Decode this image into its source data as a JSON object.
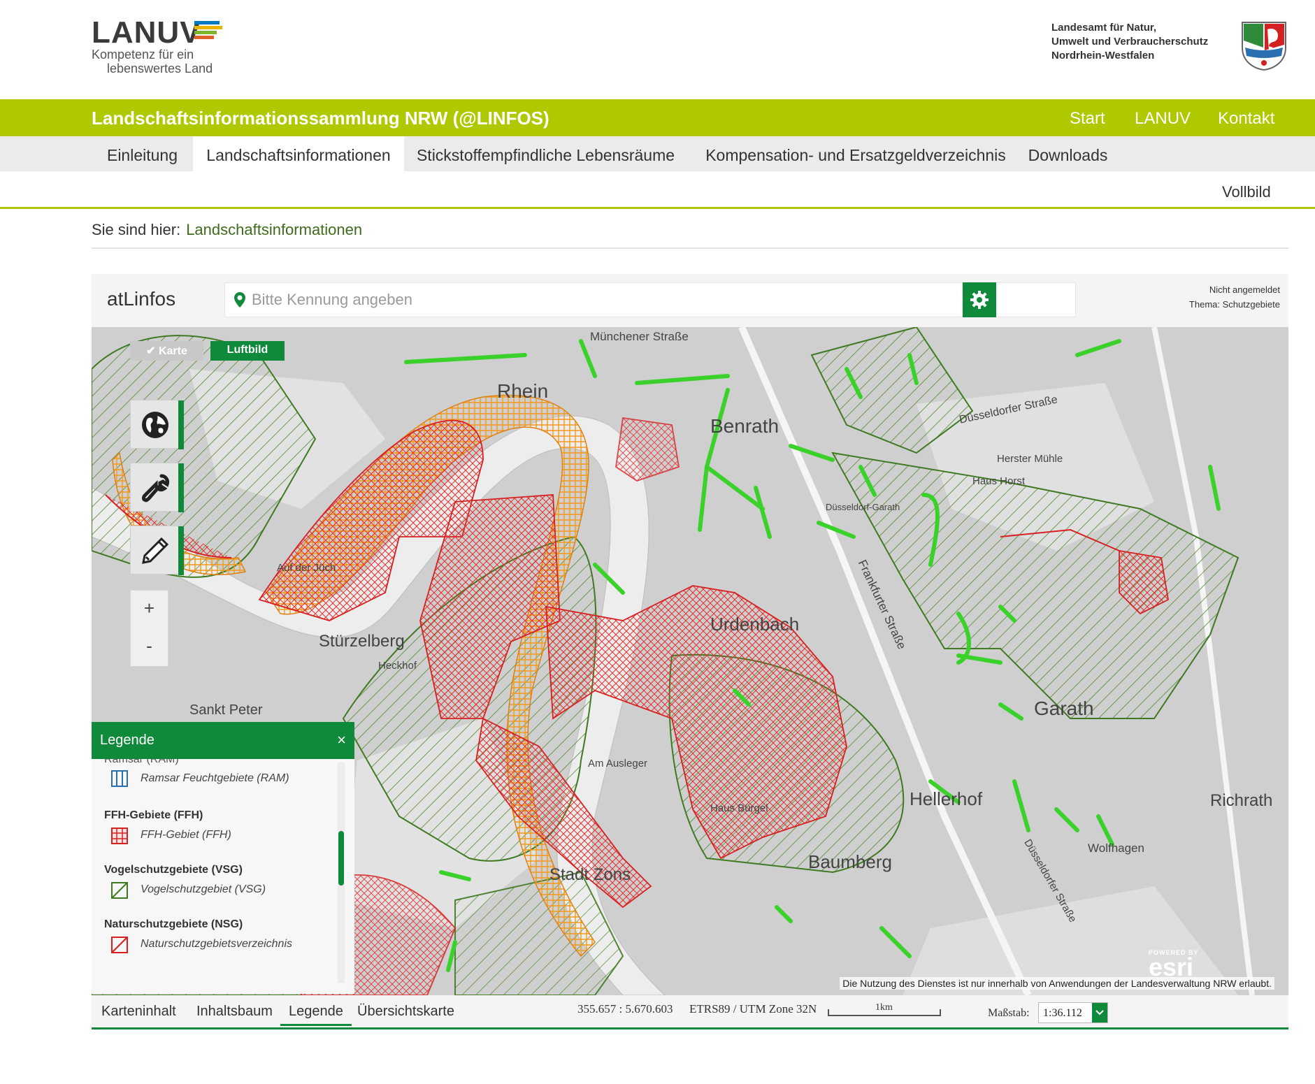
{
  "header": {
    "logo_word": "LANUV",
    "logo_tag_line1": "Kompetenz für ein",
    "logo_tag_line2": "lebenswertes Land",
    "ministry_line1": "Landesamt für Natur,",
    "ministry_line2": "Umwelt und Verbraucherschutz",
    "ministry_line3": "Nordrhein-Westfalen"
  },
  "titlebar": {
    "title": "Landschaftsinformationssammlung NRW (@LINFOS)",
    "nav": [
      "Start",
      "LANUV",
      "Kontakt"
    ]
  },
  "tabs": [
    {
      "label": "Einleitung",
      "active": false
    },
    {
      "label": "Landschaftsinformationen",
      "active": true
    },
    {
      "label": "Stickstoffempfindliche Lebensräume",
      "active": false
    },
    {
      "label": "Kompensation- und Ersatzgeldverzeichnis",
      "active": false
    },
    {
      "label": "Downloads",
      "active": false
    }
  ],
  "vollbild_label": "Vollbild",
  "breadcrumb": {
    "prefix": "Sie sind hier:",
    "current": "Landschaftsinformationen"
  },
  "map_toolbar": {
    "brand": "atLinfos",
    "search_placeholder": "Bitte Kennung angeben",
    "status_login": "Nicht angemeldet",
    "status_theme": "Thema: Schutzgebiete"
  },
  "map": {
    "toggle_karte": "Karte",
    "toggle_luftbild": "Luftbild",
    "zoom_in": "+",
    "zoom_out": "-",
    "disclaimer": "Die Nutzung des Dienstes ist nur innerhalb von Anwendungen der Landesverwaltung NRW erlaubt.",
    "place_labels": {
      "rhein": "Rhein",
      "benrath": "Benrath",
      "urdenbach": "Urdenbach",
      "garath": "Garath",
      "hellerhof": "Hellerhof",
      "baumberg": "Baumberg",
      "richrath": "Richrath",
      "stuerzelberg": "Stürzelberg",
      "sankt_peter": "Sankt Peter",
      "stadt_zons": "Stadt Zons",
      "muenchener_strasse": "Münchener Straße",
      "duesseldorfer_strasse": "Düsseldorfer Straße",
      "frankfurter_strasse": "Frankfurter Straße",
      "herster_muehle": "Herster Mühle",
      "haus_horst": "Haus Horst",
      "wolfhagen": "Wolfhagen",
      "heckhof": "Heckhof",
      "haus_buergel": "Haus Bürgel",
      "am_ausleger": "Am Ausleger",
      "duesseldorf_garath": "Düsseldorf-Garath",
      "duesseldorfer_strasse_2": "Düsseldorfer Straße",
      "auf_der_juech": "Auf der Jüch"
    },
    "colors": {
      "green": "#2f8a1f",
      "red": "#e02020",
      "orange": "#f29a1a",
      "line_green": "#3ad12a"
    }
  },
  "legend": {
    "title": "Legende",
    "close": "×",
    "partial_header": "Ramsar (RAM)",
    "groups": [
      {
        "header": "",
        "item": "Ramsar Feuchtgebiete (RAM)",
        "symbol": "ramsar-symbol"
      },
      {
        "header": "FFH-Gebiete (FFH)",
        "item": "FFH-Gebiet (FFH)",
        "symbol": "ffh-symbol"
      },
      {
        "header": "Vogelschutzgebiete (VSG)",
        "item": "Vogelschutzgebiet (VSG)",
        "symbol": "vsg-symbol"
      },
      {
        "header": "Naturschutzgebiete (NSG)",
        "item": "Naturschutzgebietsverzeichnis",
        "symbol": "nsg-symbol"
      }
    ]
  },
  "statusbar": {
    "tabs": [
      "Karteninhalt",
      "Inhaltsbaum",
      "Legende",
      "Übersichtskarte"
    ],
    "active_tab": "Legende",
    "coords": "355.657 : 5.670.603",
    "crs": "ETRS89 / UTM Zone 32N",
    "scalebar_label": "1km",
    "scale_label": "Maßstab:",
    "scale_value": "1:36.112"
  },
  "esri_label": "esri",
  "esri_powered": "POWERED BY"
}
